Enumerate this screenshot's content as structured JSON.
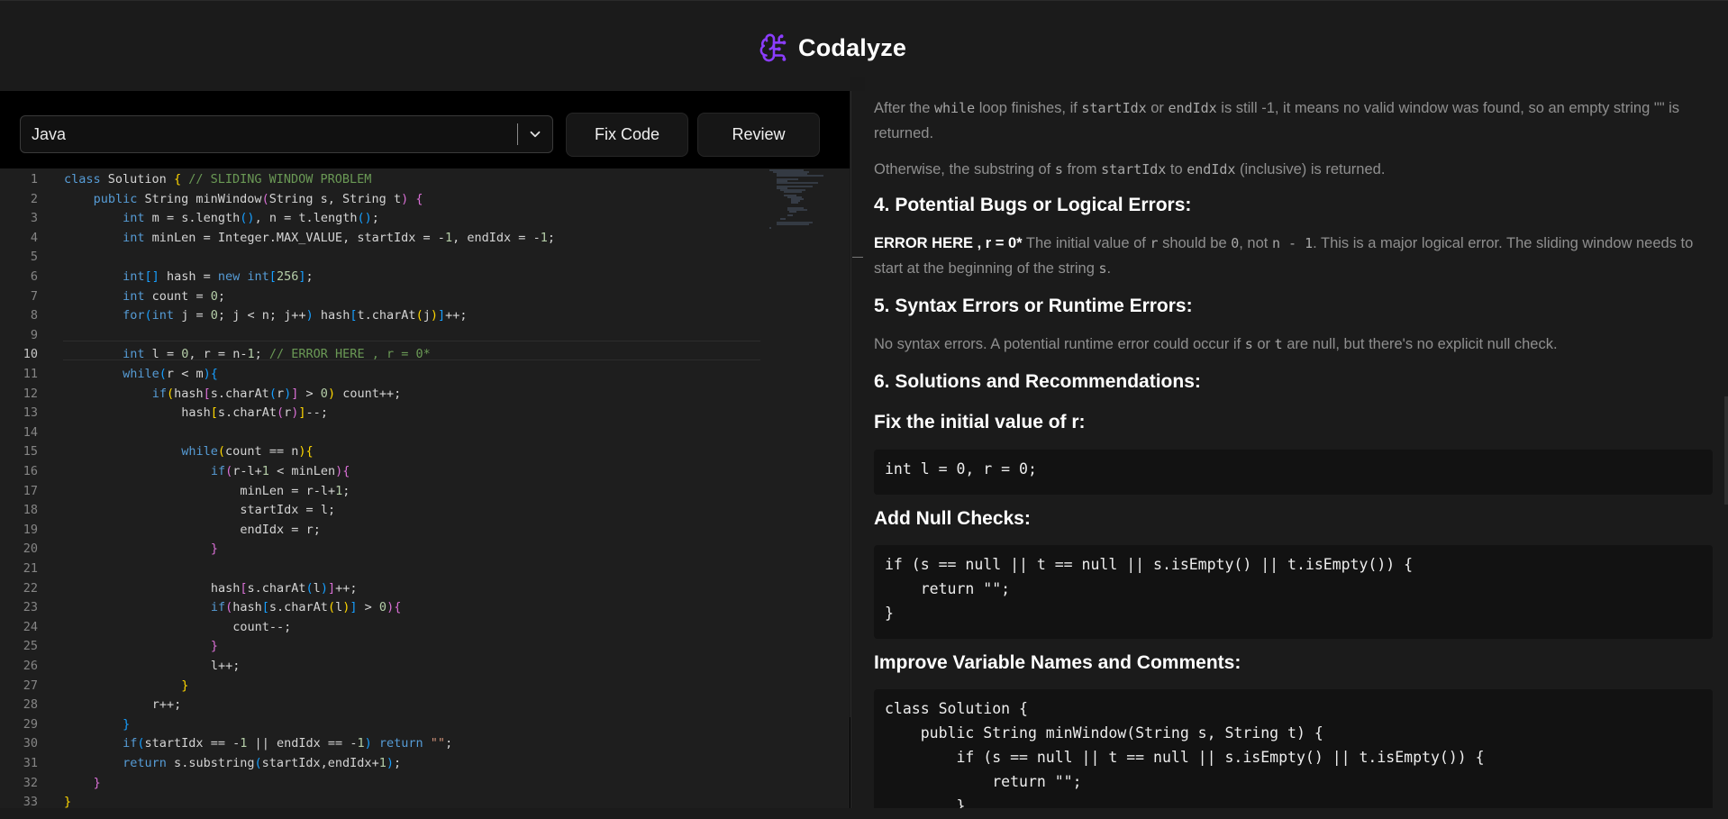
{
  "app": {
    "name": "Codalyze",
    "logo_icon": "brain-circuit-icon",
    "accent": "#8b3dff"
  },
  "toolbar": {
    "language": "Java",
    "fix_label": "Fix Code",
    "review_label": "Review"
  },
  "editor": {
    "active_line": 10,
    "line_numbers": [
      "1",
      "2",
      "3",
      "4",
      "5",
      "6",
      "7",
      "8",
      "9",
      "10",
      "11",
      "12",
      "13",
      "14",
      "15",
      "16",
      "17",
      "18",
      "19",
      "20",
      "21",
      "22",
      "23",
      "24",
      "25",
      "26",
      "27",
      "28",
      "29",
      "30",
      "31",
      "32",
      "33"
    ],
    "lines": [
      "class Solution { // SLIDING WINDOW PROBLEM",
      "    public String minWindow(String s, String t) {",
      "        int m = s.length(), n = t.length();",
      "        int minLen = Integer.MAX_VALUE, startIdx = -1, endIdx = -1;",
      "",
      "        int[] hash = new int[256];",
      "        int count = 0;",
      "        for(int j = 0; j < n; j++) hash[t.charAt(j)]++;",
      "",
      "        int l = 0, r = n-1; // ERROR HERE , r = 0*",
      "        while(r < m){",
      "            if(hash[s.charAt(r)] > 0) count++;",
      "                hash[s.charAt(r)]--;",
      "",
      "                while(count == n){",
      "                    if(r-l+1 < minLen){",
      "                        minLen = r-l+1;",
      "                        startIdx = l;",
      "                        endIdx = r;",
      "                    }",
      "",
      "                    hash[s.charAt(l)]++;",
      "                    if(hash[s.charAt(l)] > 0){",
      "                       count--;",
      "                    }",
      "                    l++;",
      "                }",
      "            r++;",
      "        }",
      "        if(startIdx == -1 || endIdx == -1) return \"\";",
      "        return s.substring(startIdx,endIdx+1);",
      "    }",
      "}"
    ]
  },
  "review": {
    "p1": {
      "a": "After the ",
      "m1": "while",
      "b": " loop finishes, if ",
      "m2": "startIdx",
      "c": " or ",
      "m3": "endIdx",
      "d": " is still -1, it means no valid window was found, so an empty string \"\" is returned."
    },
    "p2": {
      "a": "Otherwise, the substring of ",
      "m1": "s",
      "b": " from ",
      "m2": "startIdx",
      "c": " to ",
      "m3": "endIdx",
      "d": " (inclusive) is returned."
    },
    "h4": "4. Potential Bugs or Logical Errors:",
    "p3": {
      "strong": "ERROR HERE , r = 0*",
      "a": " The initial value of ",
      "m1": "r",
      "b": " should be ",
      "m2": "0",
      "c": ", not ",
      "m3": "n - 1",
      "d": ". This is a major logical error. The sliding window needs to start at the beginning of the string ",
      "m4": "s",
      "e": "."
    },
    "h5": "5. Syntax Errors or Runtime Errors:",
    "p4": {
      "a": "No syntax errors. A potential runtime error could occur if ",
      "m1": "s",
      "b": " or ",
      "m2": "t",
      "c": " are null, but there's no explicit null check."
    },
    "h6": "6. Solutions and Recommendations:",
    "h_fix": "Fix the initial value of r:",
    "code1": "int l = 0, r = 0;",
    "h_null": "Add Null Checks:",
    "code2": "if (s == null || t == null || s.isEmpty() || t.isEmpty()) {\n    return \"\";\n}",
    "h_improve": "Improve Variable Names and Comments:",
    "code3": "class Solution {\n    public String minWindow(String s, String t) {\n        if (s == null || t == null || s.isEmpty() || t.isEmpty()) {\n            return \"\";\n        }"
  }
}
